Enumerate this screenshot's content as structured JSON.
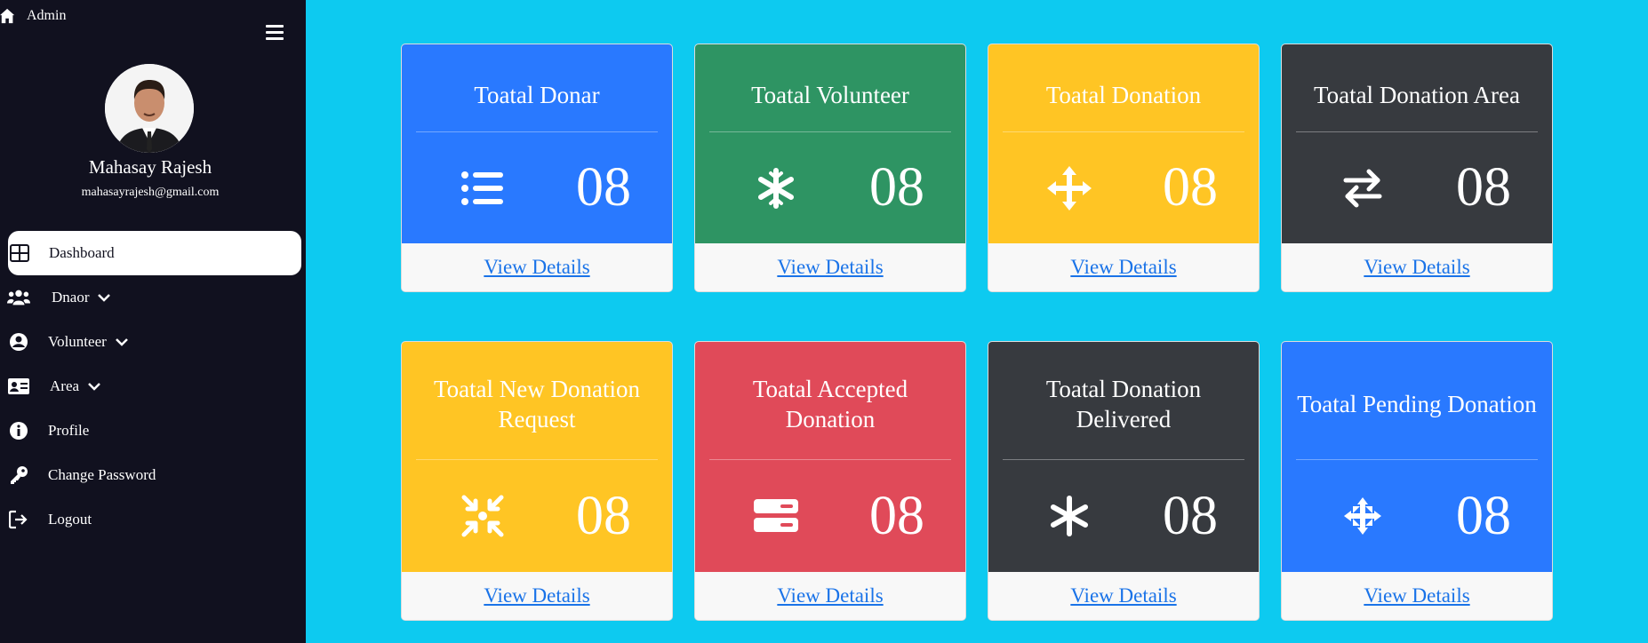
{
  "app": {
    "brand": "Admin"
  },
  "user": {
    "name": "Mahasay Rajesh",
    "email": "mahasayrajesh@gmail.com"
  },
  "nav": [
    {
      "label": "Dashboard",
      "icon": "grid-icon"
    },
    {
      "label": "Dnaor",
      "icon": "users-icon"
    },
    {
      "label": "Volunteer",
      "icon": "user-circle-icon"
    },
    {
      "label": "Area",
      "icon": "id-card-icon"
    },
    {
      "label": "Profile",
      "icon": "info-icon"
    },
    {
      "label": "Change Password",
      "icon": "key-icon"
    },
    {
      "label": "Logout",
      "icon": "logout-icon"
    }
  ],
  "cards": [
    {
      "title": "Toatal Donar",
      "value": "08",
      "link": "View Details",
      "color": "#2979ff",
      "icon": "list-icon"
    },
    {
      "title": "Toatal Volunteer",
      "value": "08",
      "link": "View Details",
      "color": "#2e9463",
      "icon": "snowflake-icon"
    },
    {
      "title": "Toatal Donation",
      "value": "08",
      "link": "View Details",
      "color": "#ffc524",
      "icon": "move-arrows-icon"
    },
    {
      "title": "Toatal Donation Area",
      "value": "08",
      "link": "View Details",
      "color": "#373a3f",
      "icon": "swap-arrows-icon"
    },
    {
      "title": "Toatal New Donation Request",
      "value": "08",
      "link": "View Details",
      "color": "#ffc524",
      "icon": "compress-arrows-icon"
    },
    {
      "title": "Toatal Accepted Donation",
      "value": "08",
      "link": "View Details",
      "color": "#e04a59",
      "icon": "server-icon"
    },
    {
      "title": "Toatal Donation Delivered",
      "value": "08",
      "link": "View Details",
      "color": "#373a3f",
      "icon": "asterisk-icon"
    },
    {
      "title": "Toatal Pending Donation",
      "value": "08",
      "link": "View Details",
      "color": "#2979ff",
      "icon": "diamond-arrows-icon"
    }
  ]
}
